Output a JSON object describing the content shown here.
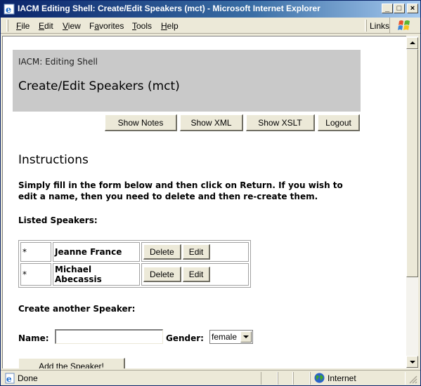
{
  "window": {
    "title": "IACM Editing Shell: Create/Edit Speakers (mct) - Microsoft Internet Explorer",
    "controls": {
      "minimize": "_",
      "maximize": "□",
      "close": "×"
    }
  },
  "menubar": {
    "items": [
      {
        "label": "File",
        "accel": "F"
      },
      {
        "label": "Edit",
        "accel": "E"
      },
      {
        "label": "View",
        "accel": "V"
      },
      {
        "label": "Favorites",
        "accel": "a"
      },
      {
        "label": "Tools",
        "accel": "T"
      },
      {
        "label": "Help",
        "accel": "H"
      }
    ],
    "links_label": "Links"
  },
  "header": {
    "subtitle": "IACM: Editing Shell",
    "title": "Create/Edit Speakers (mct)"
  },
  "toolbar": {
    "show_notes": "Show Notes",
    "show_xml": "Show XML",
    "show_xslt": "Show XSLT",
    "logout": "Logout"
  },
  "instructions": {
    "heading": "Instructions",
    "text": "Simply fill in the form below and then click on Return. If you wish to edit a name, then you need to delete and then re-create them."
  },
  "speakers": {
    "label": "Listed Speakers:",
    "rows": [
      {
        "marker": "*",
        "name": "Jeanne France",
        "delete_label": "Delete",
        "edit_label": "Edit"
      },
      {
        "marker": "*",
        "name": "Michael Abecassis",
        "delete_label": "Delete",
        "edit_label": "Edit"
      }
    ]
  },
  "create_form": {
    "heading": "Create another Speaker:",
    "name_label": "Name:",
    "name_value": "",
    "gender_label": "Gender:",
    "gender_selected": "female",
    "submit_label": "Add the Speaker!"
  },
  "statusbar": {
    "status": "Done",
    "zone": "Internet"
  },
  "scrollbar": {
    "position_fraction": 0.0,
    "visible_fraction": 0.73
  }
}
